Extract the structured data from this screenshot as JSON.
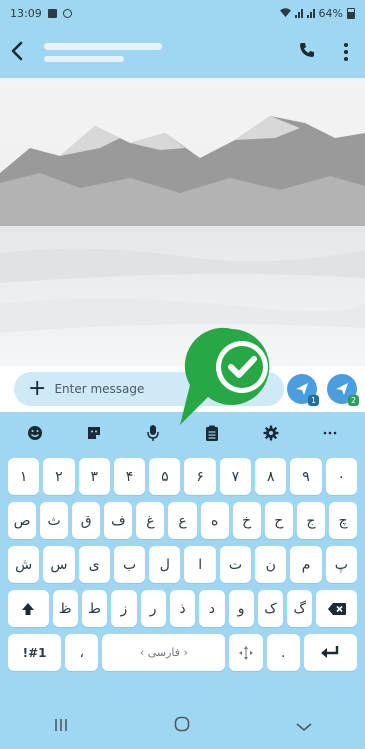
{
  "status_bar": {
    "time": "13:09",
    "battery": "64%",
    "signal_icons": [
      "wifi-icon",
      "signal-icon",
      "signal-icon",
      "battery-icon"
    ]
  },
  "app_bar": {
    "back_icon": "back-arrow-icon",
    "call_icon": "phone-icon",
    "more_icon": "more-vertical-icon"
  },
  "composer": {
    "attach_icon": "plus-icon",
    "placeholder": "Enter message",
    "send_sim1_badge": "1",
    "send_sim2_badge": "2"
  },
  "keyboard": {
    "toolbar": [
      "emoji-icon",
      "sticker-icon",
      "mic-icon",
      "clipboard-icon",
      "settings-icon",
      "more-horizontal-icon"
    ],
    "row1": [
      "١",
      "٢",
      "٣",
      "۴",
      "۵",
      "۶",
      "٧",
      "٨",
      "٩",
      "٠"
    ],
    "row2": [
      "ص",
      "ث",
      "ق",
      "ف",
      "غ",
      "ع",
      "ه",
      "خ",
      "ح",
      "ج",
      "چ"
    ],
    "row3": [
      "ش",
      "س",
      "ی",
      "ب",
      "ل",
      "ا",
      "ت",
      "ن",
      "م",
      "پ"
    ],
    "row4": [
      "ظ",
      "ط",
      "ز",
      "ر",
      "ذ",
      "د",
      "و",
      "ک",
      "گ"
    ],
    "symbols_key": "!#1",
    "comma_key": "،",
    "space_label": "فارسی",
    "period_key": ".",
    "shift_icon": "shift-arrow-icon",
    "backspace_icon": "backspace-icon",
    "enter_icon": "enter-icon",
    "cursor_icon": "cursor-move-icon"
  },
  "nav_bar": [
    "recent-apps-icon",
    "home-icon",
    "back-chevron-icon"
  ],
  "colors": {
    "bar": "#9fd6f2",
    "input": "#cfe9f7",
    "send": "#4a9ee0",
    "check": "#28a745"
  }
}
